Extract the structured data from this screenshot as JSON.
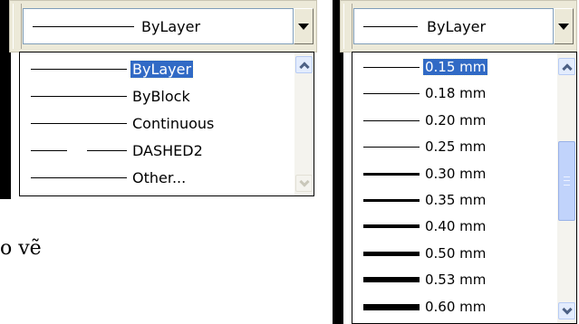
{
  "linetype": {
    "combo_value": "ByLayer",
    "items": [
      {
        "label": "ByLayer",
        "selected": true,
        "style": "solid"
      },
      {
        "label": "ByBlock",
        "selected": false,
        "style": "solid"
      },
      {
        "label": "Continuous",
        "selected": false,
        "style": "solid"
      },
      {
        "label": "DASHED2",
        "selected": false,
        "style": "dashed"
      },
      {
        "label": "Other...",
        "selected": false,
        "style": "solid"
      }
    ]
  },
  "lineweight": {
    "combo_value": "ByLayer",
    "items": [
      {
        "label": "0.15 mm",
        "selected": true,
        "weight": 1
      },
      {
        "label": "0.18 mm",
        "selected": false,
        "weight": 1
      },
      {
        "label": "0.20 mm",
        "selected": false,
        "weight": 1
      },
      {
        "label": "0.25 mm",
        "selected": false,
        "weight": 1
      },
      {
        "label": "0.30 mm",
        "selected": false,
        "weight": 3
      },
      {
        "label": "0.35 mm",
        "selected": false,
        "weight": 3
      },
      {
        "label": "0.40 mm",
        "selected": false,
        "weight": 4
      },
      {
        "label": "0.50 mm",
        "selected": false,
        "weight": 5
      },
      {
        "label": "0.53 mm",
        "selected": false,
        "weight": 6
      },
      {
        "label": "0.60 mm",
        "selected": false,
        "weight": 7
      }
    ]
  },
  "background_text": "o vẽ",
  "colors": {
    "selection": "#316ac5",
    "scrollbar_thumb": "#c1d3fb"
  }
}
